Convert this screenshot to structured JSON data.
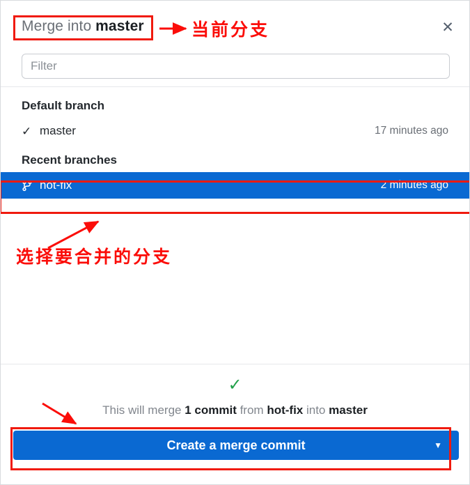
{
  "dialog": {
    "title_prefix": "Merge into ",
    "title_branch": "master",
    "close_icon_glyph": "✕",
    "close_icon_name": "close-icon"
  },
  "filter": {
    "placeholder": "Filter",
    "value": ""
  },
  "groups": [
    {
      "header": "Default branch",
      "rows": [
        {
          "icon": "check-icon",
          "icon_glyph": "✓",
          "name": "master",
          "time": "17 minutes ago",
          "selected": false
        }
      ]
    },
    {
      "header": "Recent branches",
      "rows": [
        {
          "icon": "git-branch-icon",
          "icon_glyph": "",
          "name": "hot-fix",
          "time": "2 minutes ago",
          "selected": true
        }
      ]
    }
  ],
  "footer": {
    "check_glyph": "✓",
    "status": {
      "part1": "This will merge ",
      "part2": "1 commit",
      "part3": " from ",
      "part4": "hot-fix",
      "part5": " into ",
      "part6": "master"
    },
    "button_label": "Create a merge commit",
    "button_caret": "▼"
  },
  "annotations": {
    "current_branch": "当前分支",
    "choose_branch": "选择要合并的分支"
  },
  "colors": {
    "accent_blue": "#0a69d2",
    "annotation_red": "#f01a0e",
    "success_green": "#22a04a",
    "muted_text": "#6a6f76",
    "strong_text": "#1b1f23"
  }
}
